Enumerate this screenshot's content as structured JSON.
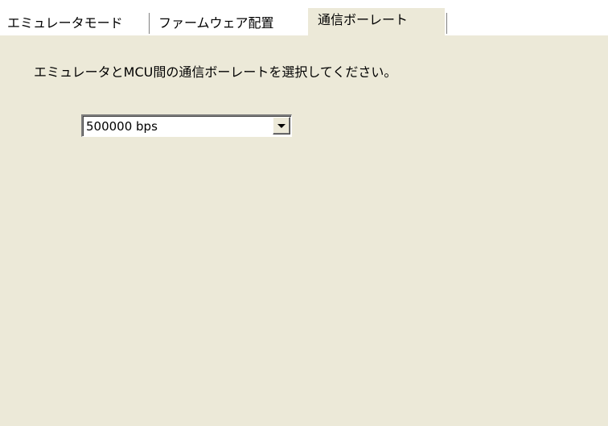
{
  "tabs": [
    {
      "label": "エミュレータモード",
      "active": false
    },
    {
      "label": "ファームウェア配置",
      "active": false
    },
    {
      "label": "通信ボーレート",
      "active": true
    }
  ],
  "panel": {
    "instruction": "エミュレータとMCU間の通信ボーレートを選択してください。",
    "baud_rate": {
      "selected": "500000 bps",
      "icon": "chevron-down-icon"
    }
  },
  "colors": {
    "panel_bg": "#ece9d8",
    "tabstrip_bg": "#ffffff"
  }
}
